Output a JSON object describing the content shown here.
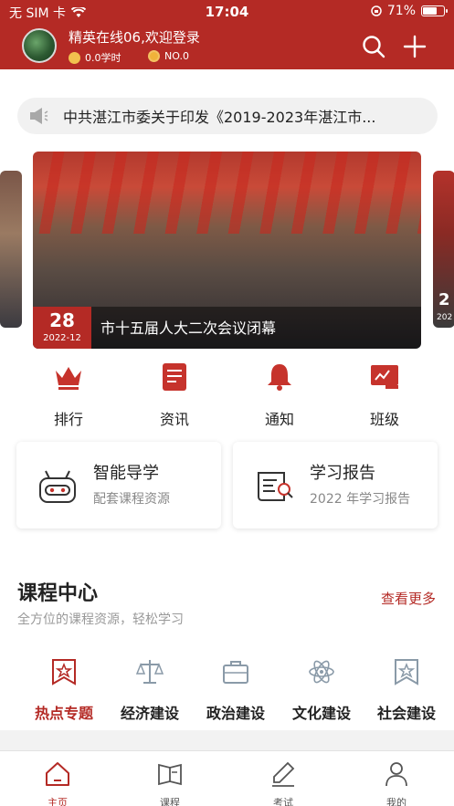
{
  "status_bar": {
    "carrier": "无 SIM 卡",
    "time": "17:04",
    "battery": "71%",
    "battery_level": 0.71
  },
  "header": {
    "welcome": "精英在线06,欢迎登录",
    "study_hours": "0.0学时",
    "rank": "NO.0",
    "colors": {
      "brand": "#b42a25"
    }
  },
  "notice": {
    "text": "中共湛江市委关于印发《2019-2023年湛江市..."
  },
  "carousel": {
    "day": "28",
    "year_month": "2022-12",
    "title": "市十五届人大二次会议闭幕",
    "next_day": "2",
    "next_year": "202"
  },
  "quick_nav": [
    {
      "label": "排行",
      "icon": "crown-icon"
    },
    {
      "label": "资讯",
      "icon": "news-icon"
    },
    {
      "label": "通知",
      "icon": "bell-icon"
    },
    {
      "label": "班级",
      "icon": "class-icon"
    }
  ],
  "cards": [
    {
      "title": "智能导学",
      "subtitle": "配套课程资源",
      "icon": "robot-icon"
    },
    {
      "title": "学习报告",
      "subtitle": "2022 年学习报告",
      "icon": "report-icon"
    }
  ],
  "course_center": {
    "title": "课程中心",
    "subtitle": "全方位的课程资源，轻松学习",
    "more": "查看更多",
    "categories": [
      {
        "label": "热点专题",
        "icon": "star-badge-icon",
        "active": true
      },
      {
        "label": "经济建设",
        "icon": "scale-icon",
        "active": false
      },
      {
        "label": "政治建设",
        "icon": "briefcase-icon",
        "active": false
      },
      {
        "label": "文化建设",
        "icon": "atom-icon",
        "active": false
      },
      {
        "label": "社会建设",
        "icon": "star-badge-icon",
        "active": false
      }
    ]
  },
  "tabbar": [
    {
      "label": "主页",
      "icon": "home-icon",
      "active": true
    },
    {
      "label": "课程",
      "icon": "book-icon",
      "active": false
    },
    {
      "label": "考试",
      "icon": "pencil-icon",
      "active": false
    },
    {
      "label": "我的",
      "icon": "user-icon",
      "active": false
    }
  ]
}
